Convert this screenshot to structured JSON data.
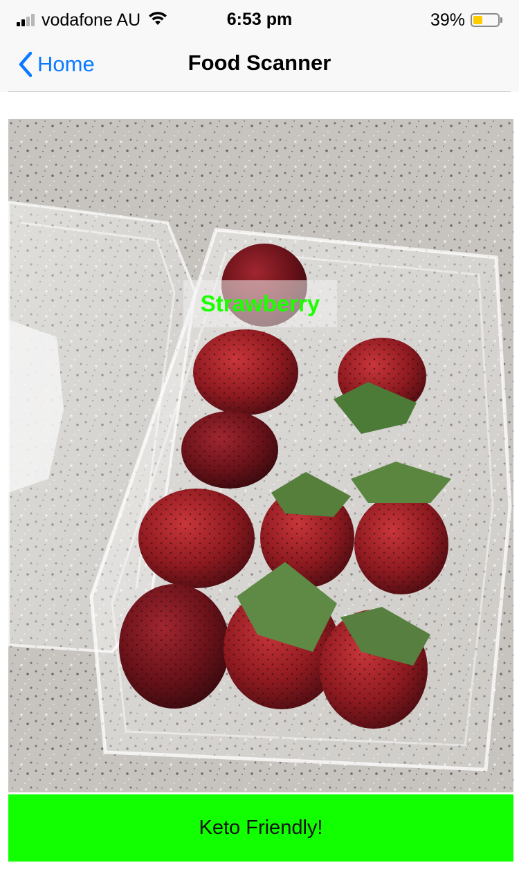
{
  "status_bar": {
    "carrier": "vodafone AU",
    "time": "6:53 pm",
    "battery_percent": "39%",
    "battery_level": 0.39,
    "battery_color": "#ffcc00",
    "signal_bars_active": 2,
    "signal_bars_total": 4,
    "icons": [
      "signal-icon",
      "wifi-icon",
      "battery-icon"
    ]
  },
  "nav": {
    "back_label": "Home",
    "back_icon": "chevron-left-icon",
    "title": "Food Scanner",
    "accent_color": "#0a7aff"
  },
  "camera": {
    "detection_label": "Strawberry",
    "detection_color": "#1bff00"
  },
  "result": {
    "text": "Keto Friendly!",
    "background_color": "#11ff00"
  }
}
